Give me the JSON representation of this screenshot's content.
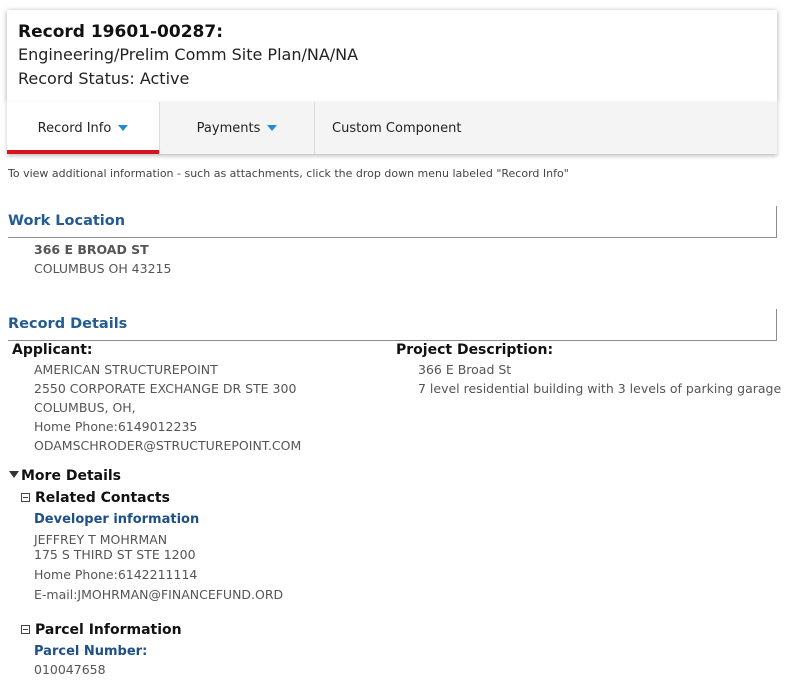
{
  "record": {
    "title": "Record 19601-00287:",
    "type_line": "Engineering/Prelim Comm Site Plan/NA/NA",
    "status_line": "Record Status: Active"
  },
  "tabs": [
    {
      "label": "Record Info",
      "has_dropdown": true,
      "active": true
    },
    {
      "label": "Payments",
      "has_dropdown": true,
      "active": false
    },
    {
      "label": "Custom Component",
      "has_dropdown": false,
      "active": false
    }
  ],
  "hint": "To view additional information - such as attachments, click the drop down menu labeled \"Record Info\"",
  "work_location": {
    "heading": "Work Location",
    "street": "366 E BROAD ST",
    "city_line": "COLUMBUS OH 43215"
  },
  "record_details": {
    "heading": "Record Details",
    "applicant": {
      "label": "Applicant:",
      "lines": [
        "AMERICAN STRUCTUREPOINT",
        "2550 CORPORATE EXCHANGE DR STE 300",
        "COLUMBUS, OH,",
        "Home Phone:6149012235",
        "ODAMSCHRODER@STRUCTUREPOINT.COM"
      ]
    },
    "project_description": {
      "label": "Project Description:",
      "lines": [
        "366 E Broad St",
        "7 level residential building with 3 levels of parking garage"
      ]
    }
  },
  "more_details": {
    "label": "More Details",
    "related_contacts": {
      "label": "Related Contacts",
      "developer_label": "Developer information",
      "name": "JEFFREY T MOHRMAN",
      "address": "175 S THIRD ST STE 1200",
      "phone": "Home Phone:6142211114",
      "email": "E-mail:JMOHRMAN@FINANCEFUND.ORD"
    },
    "parcel": {
      "label": "Parcel Information",
      "number_label": "Parcel Number:",
      "number": "010047658"
    }
  },
  "colors": {
    "accent_red": "#d6131f",
    "heading_blue": "#245b90",
    "caret_blue": "#1f8ed0"
  }
}
